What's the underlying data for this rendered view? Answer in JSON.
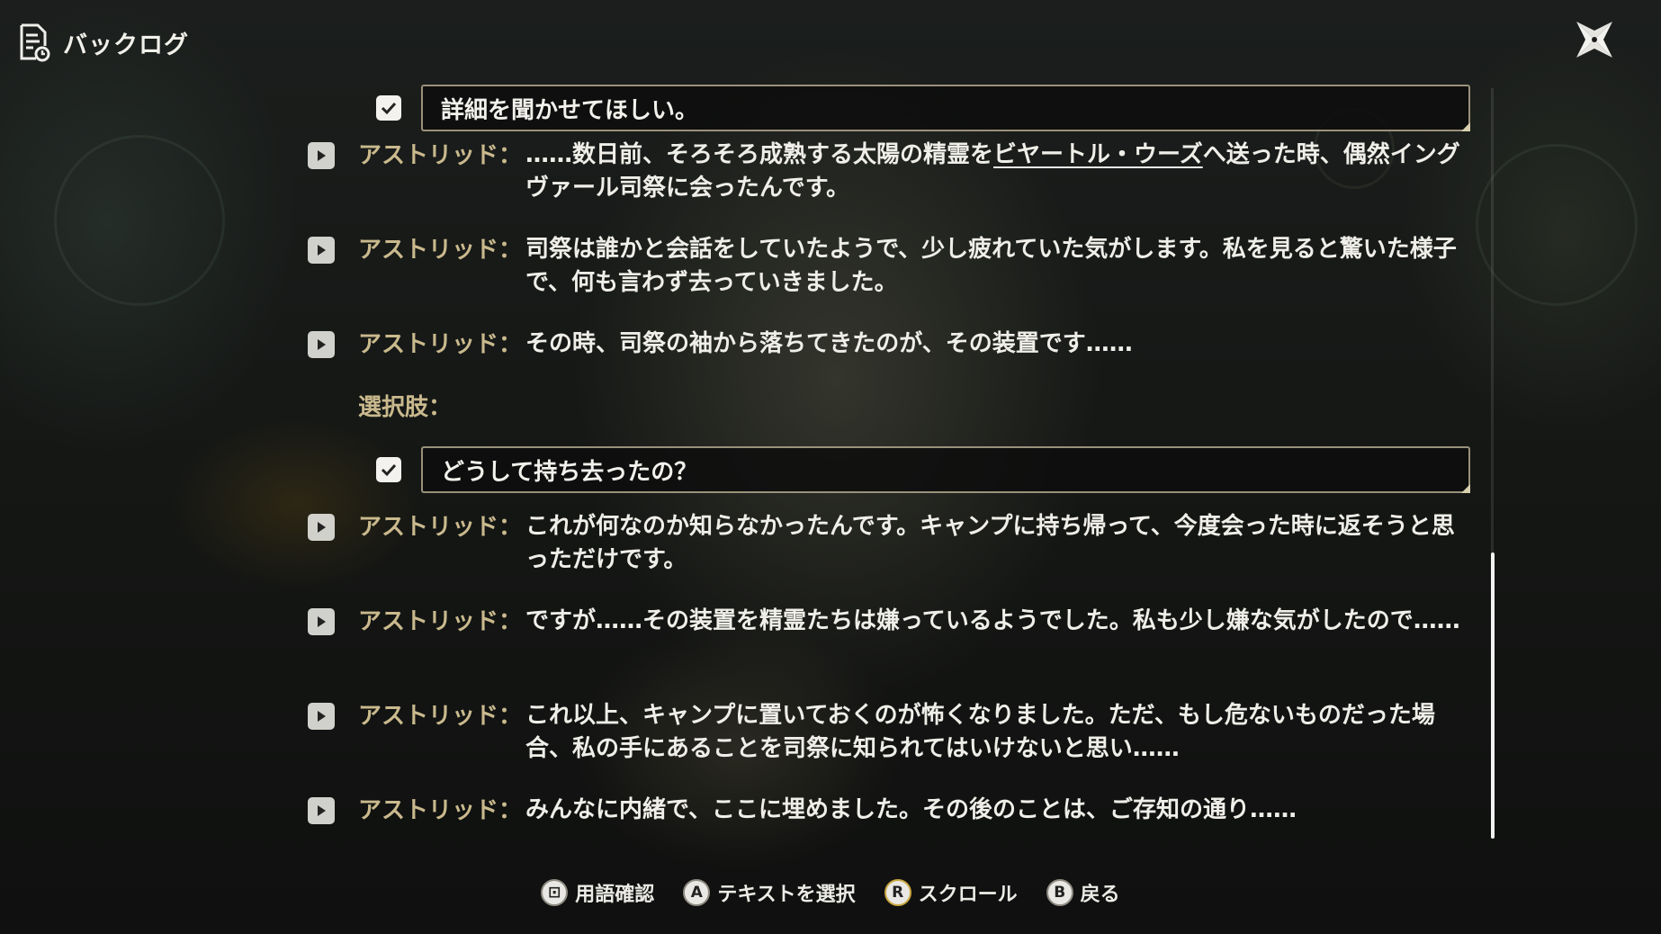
{
  "header": {
    "title": "バックログ",
    "icon": "document-icon",
    "close_icon": "close-star-icon"
  },
  "entries": [
    {
      "kind": "choice",
      "text": "詳細を聞かせてほしい。",
      "selected": true
    },
    {
      "kind": "line",
      "speaker": "アストリッド：",
      "pre": "……数日前、そろそろ成熟する太陽の精霊を",
      "keyword": "ビヤートル・ウーズ",
      "post": "へ送った時、偶然イングヴァール司祭に会ったんです。"
    },
    {
      "kind": "line",
      "speaker": "アストリッド：",
      "text": "司祭は誰かと会話をしていたようで、少し疲れていた気がします。私を見ると驚いた様子で、何も言わず去っていきました。"
    },
    {
      "kind": "line",
      "speaker": "アストリッド：",
      "text": "その時、司祭の袖から落ちてきたのが、その装置です……"
    },
    {
      "kind": "choice_label",
      "text": "選択肢："
    },
    {
      "kind": "choice",
      "text": "どうして持ち去ったの？",
      "selected": true
    },
    {
      "kind": "line",
      "speaker": "アストリッド：",
      "text": "これが何なのか知らなかったんです。キャンプに持ち帰って、今度会った時に返そうと思っただけです。"
    },
    {
      "kind": "line",
      "speaker": "アストリッド：",
      "text": "ですが……その装置を精霊たちは嫌っているようでした。私も少し嫌な気がしたので……"
    },
    {
      "kind": "line",
      "speaker": "アストリッド：",
      "text": "これ以上、キャンプに置いておくのが怖くなりました。ただ、もし危ないものだった場合、私の手にあることを司祭に知られてはいけないと思い……"
    },
    {
      "kind": "line",
      "speaker": "アストリッド：",
      "text": "みんなに内緒で、ここに埋めました。その後のことは、ご存知の通り……"
    }
  ],
  "scroll": {
    "position": 0.62
  },
  "footer": {
    "hints": [
      {
        "button": "⊡",
        "icon": "glossary-button-icon",
        "label": "用語確認"
      },
      {
        "button": "A",
        "icon": "a-button-icon",
        "label": "テキストを選択"
      },
      {
        "button": "R",
        "icon": "r-stick-icon",
        "label": "スクロール"
      },
      {
        "button": "B",
        "icon": "b-button-icon",
        "label": "戻る"
      }
    ]
  },
  "colors": {
    "speaker": "#c9b98d",
    "text": "#efeee8",
    "accent": "#d8cfae"
  }
}
